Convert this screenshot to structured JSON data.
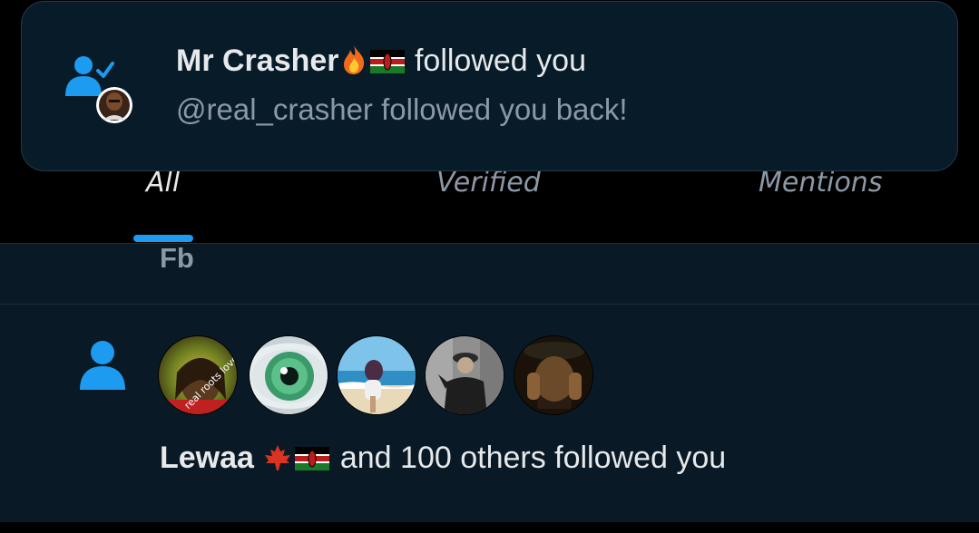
{
  "toast": {
    "user_name": "Mr Crasher",
    "action_text": "followed you",
    "subtitle": "@real_crasher followed you back!",
    "icon": "user-follow-check-icon"
  },
  "tabs": [
    {
      "label": "All",
      "active": true
    },
    {
      "label": "Verified",
      "active": false
    },
    {
      "label": "Mentions",
      "active": false
    }
  ],
  "filter": {
    "label": "Fb"
  },
  "notification": {
    "icon": "person-icon",
    "user_name": "Lewaa",
    "rest_text": "and 100 others followed you",
    "avatars": [
      {
        "name": "avatar-1",
        "overlay_text": "real roots love"
      },
      {
        "name": "avatar-2"
      },
      {
        "name": "avatar-3"
      },
      {
        "name": "avatar-4"
      },
      {
        "name": "avatar-5"
      }
    ]
  },
  "colors": {
    "accent": "#1d9bf0",
    "card_bg": "#091a26",
    "muted_text": "#8b98a5"
  }
}
